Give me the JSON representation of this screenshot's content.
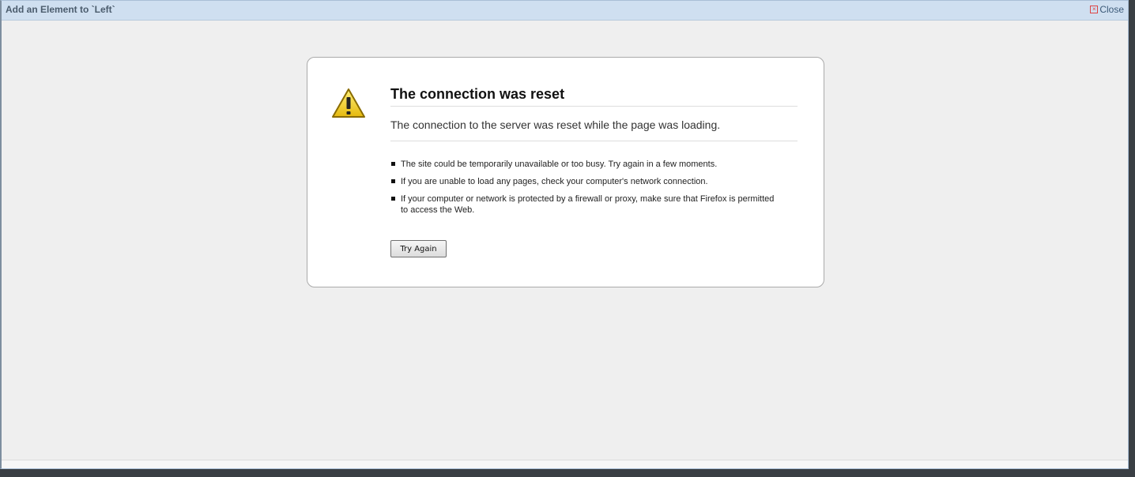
{
  "window": {
    "title": "Add an Element to `Left`",
    "close_label": "Close"
  },
  "error": {
    "title": "The connection was reset",
    "description": "The connection to the server was reset while the page was loading.",
    "suggestions": [
      "The site could be temporarily unavailable or too busy. Try again in a few moments.",
      "If you are unable to load any pages, check your computer's network connection.",
      "If your computer or network is protected by a firewall or proxy, make sure that Firefox is permitted to access the Web."
    ],
    "button_label": "Try Again"
  },
  "icons": {
    "warning": "warning-triangle-icon",
    "close": "close-icon"
  },
  "colors": {
    "title_bar": "#cfdff0",
    "warning_yellow": "#f2d224",
    "close_red": "#dd4444"
  }
}
